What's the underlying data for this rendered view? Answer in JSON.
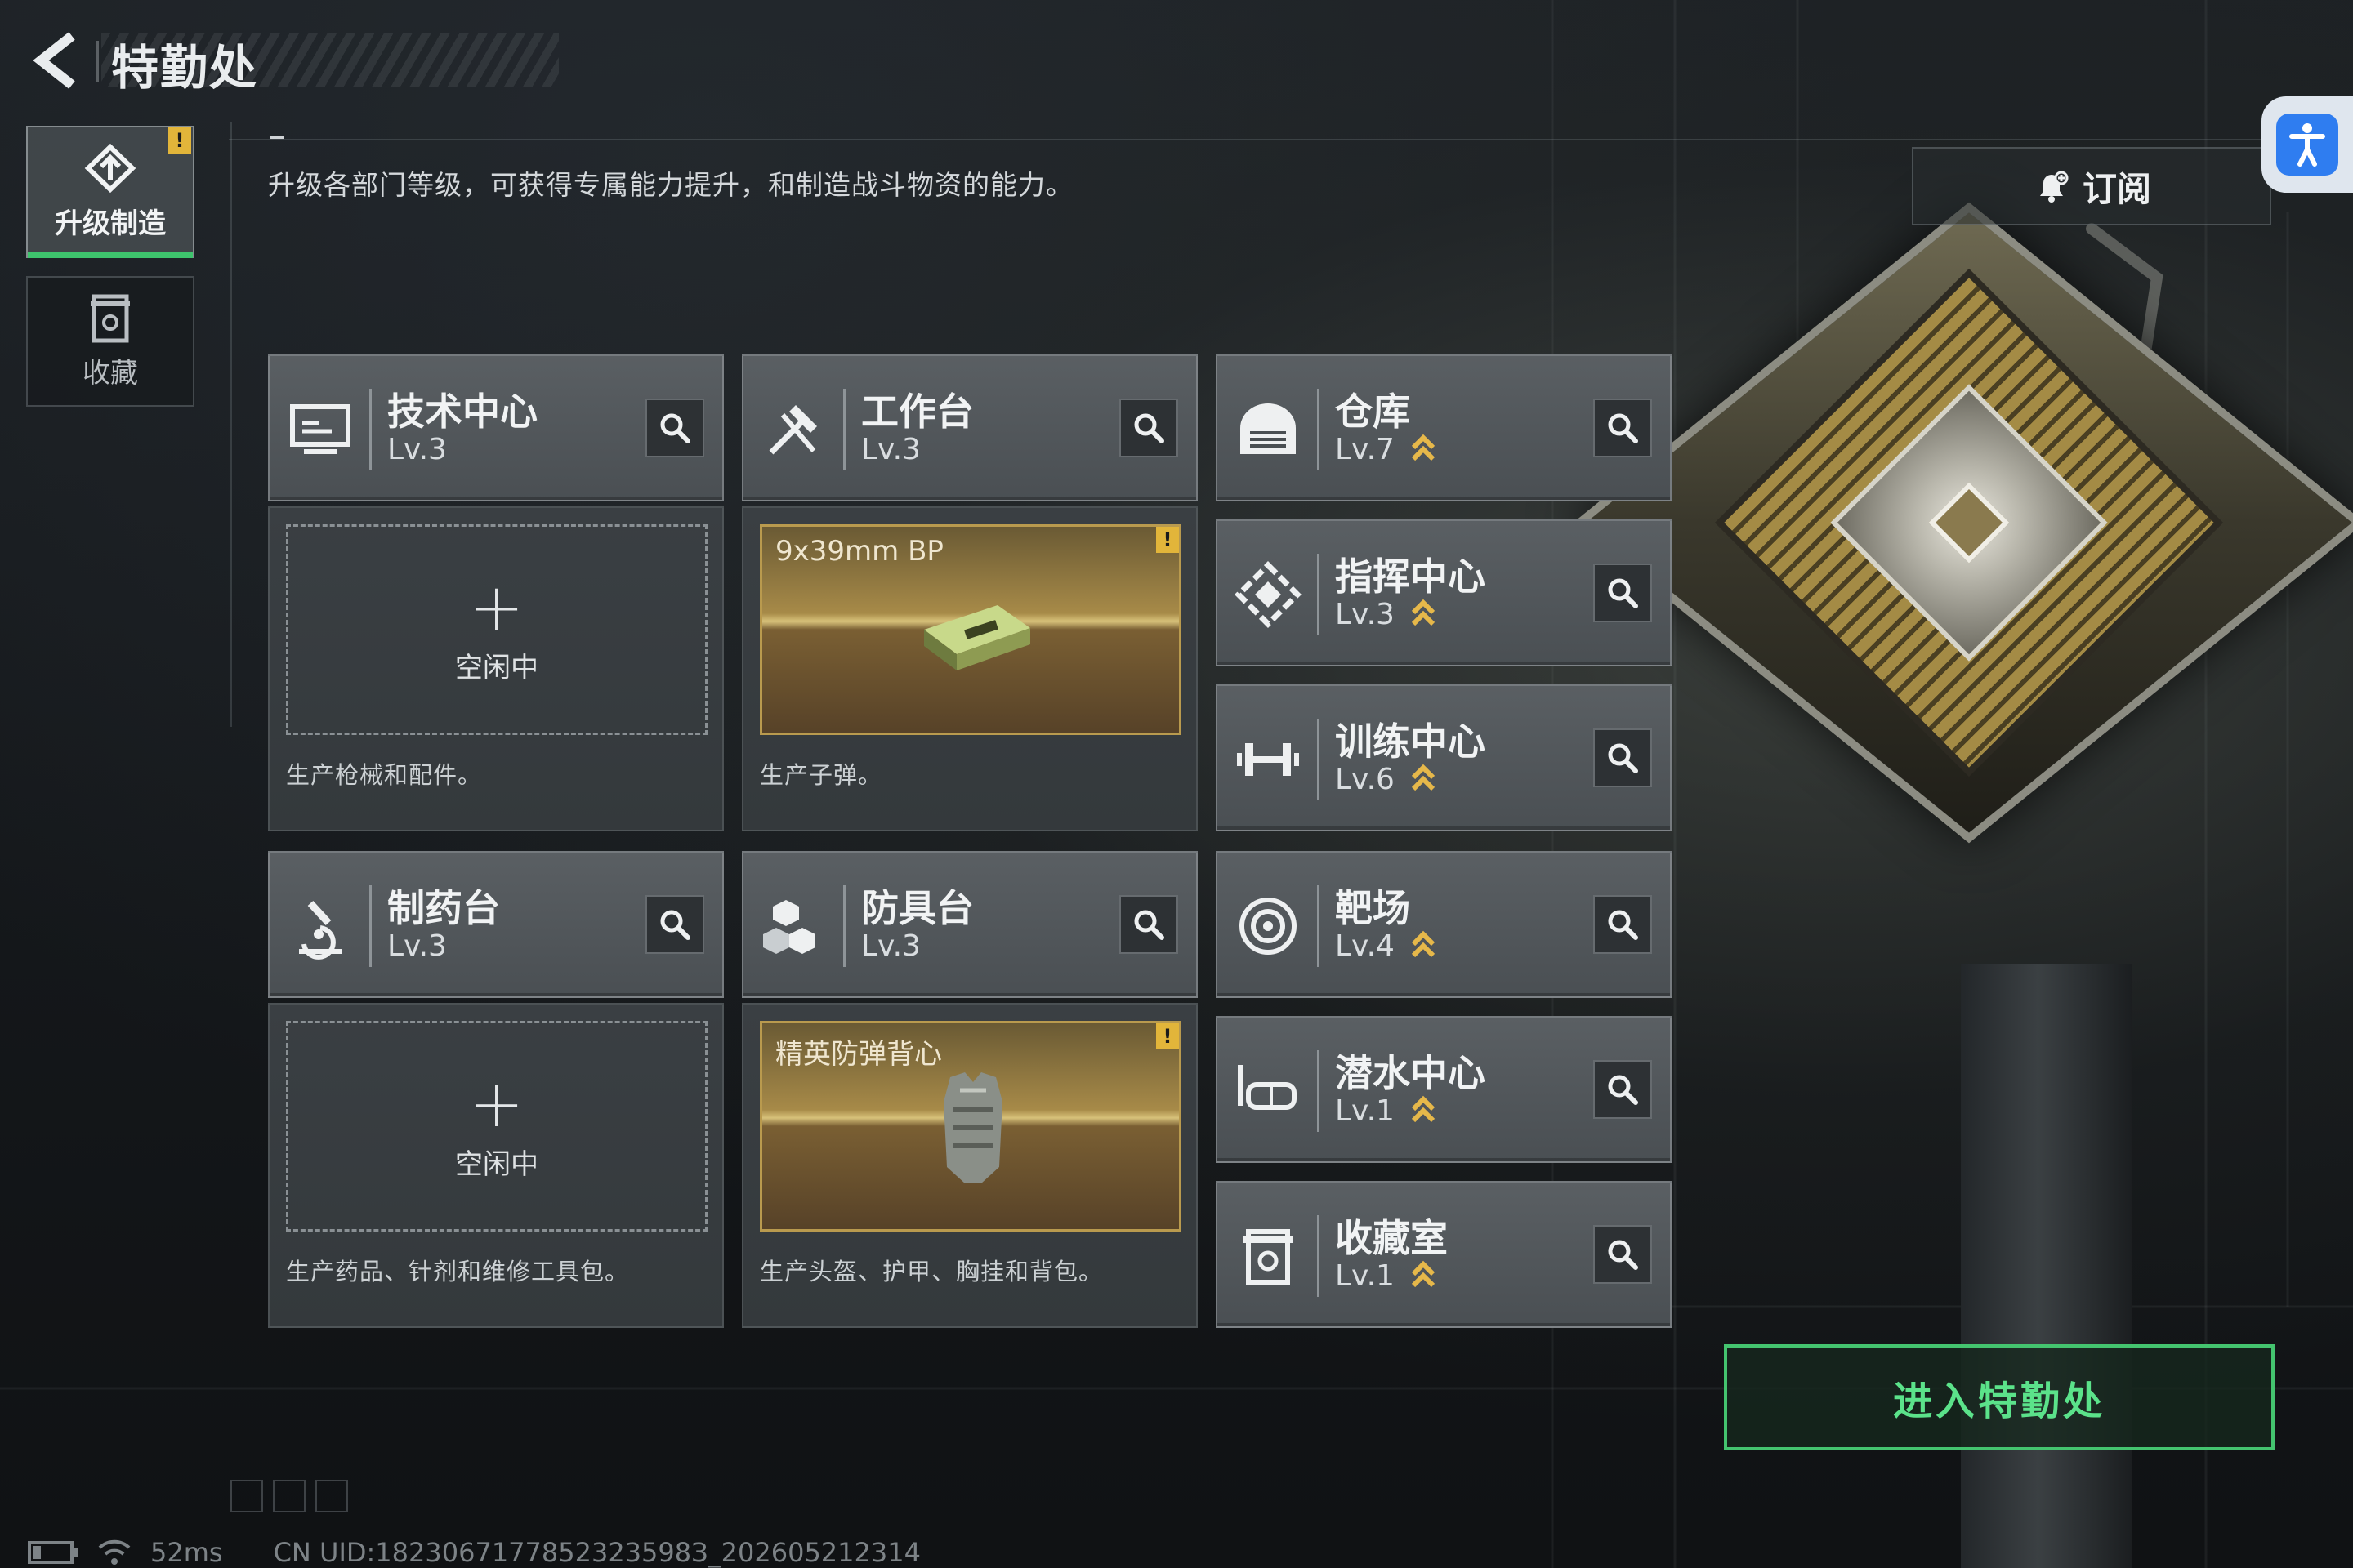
{
  "header": {
    "title": "特勤处",
    "description": "升级各部门等级，可获得专属能力提升，和制造战斗物资的能力。",
    "subscribe_label": "订阅"
  },
  "side_tabs": [
    {
      "label": "升级制造",
      "active": true,
      "icon": "upgrade-icon",
      "warning": "!"
    },
    {
      "label": "收藏",
      "active": false,
      "icon": "collection-icon"
    }
  ],
  "facilities": [
    {
      "name": "技术中心",
      "level": "Lv.3",
      "icon": "monitor-icon",
      "upgradable": false
    },
    {
      "name": "工作台",
      "level": "Lv.3",
      "icon": "tools-icon",
      "upgradable": false
    },
    {
      "name": "仓库",
      "level": "Lv.7",
      "icon": "warehouse-icon",
      "upgradable": true
    },
    {
      "name": "指挥中心",
      "level": "Lv.3",
      "icon": "command-icon",
      "upgradable": true
    },
    {
      "name": "训练中心",
      "level": "Lv.6",
      "icon": "dumbbell-icon",
      "upgradable": true
    },
    {
      "name": "制药台",
      "level": "Lv.3",
      "icon": "microscope-icon",
      "upgradable": false
    },
    {
      "name": "防具台",
      "level": "Lv.3",
      "icon": "armor-blocks-icon",
      "upgradable": false
    },
    {
      "name": "靶场",
      "level": "Lv.4",
      "icon": "target-icon",
      "upgradable": true
    },
    {
      "name": "潜水中心",
      "level": "Lv.1",
      "icon": "diving-mask-icon",
      "upgradable": true
    },
    {
      "name": "收藏室",
      "level": "Lv.1",
      "icon": "collection-room-icon",
      "upgradable": true
    }
  ],
  "production": [
    {
      "state": "idle",
      "plus": "+",
      "status": "空闲中",
      "description": "生产枪械和配件。"
    },
    {
      "state": "producing",
      "item": "9x39mm BP",
      "warning": "!",
      "description": "生产子弹。"
    },
    {
      "state": "idle",
      "plus": "+",
      "status": "空闲中",
      "description": "生产药品、针剂和维修工具包。"
    },
    {
      "state": "producing",
      "item": "精英防弹背心",
      "warning": "!",
      "description": "生产头盔、护甲、胸挂和背包。"
    }
  ],
  "enter_button": "进入特勤处",
  "footer": {
    "ping": "52ms",
    "uid": "CN UID:1823067177852323598З_202605212314"
  },
  "colors": {
    "accent_green": "#44c46f",
    "warning_yellow": "#e2b53a",
    "upgrade_gold": "#e6b84a",
    "a11y_blue": "#2f7df0"
  }
}
